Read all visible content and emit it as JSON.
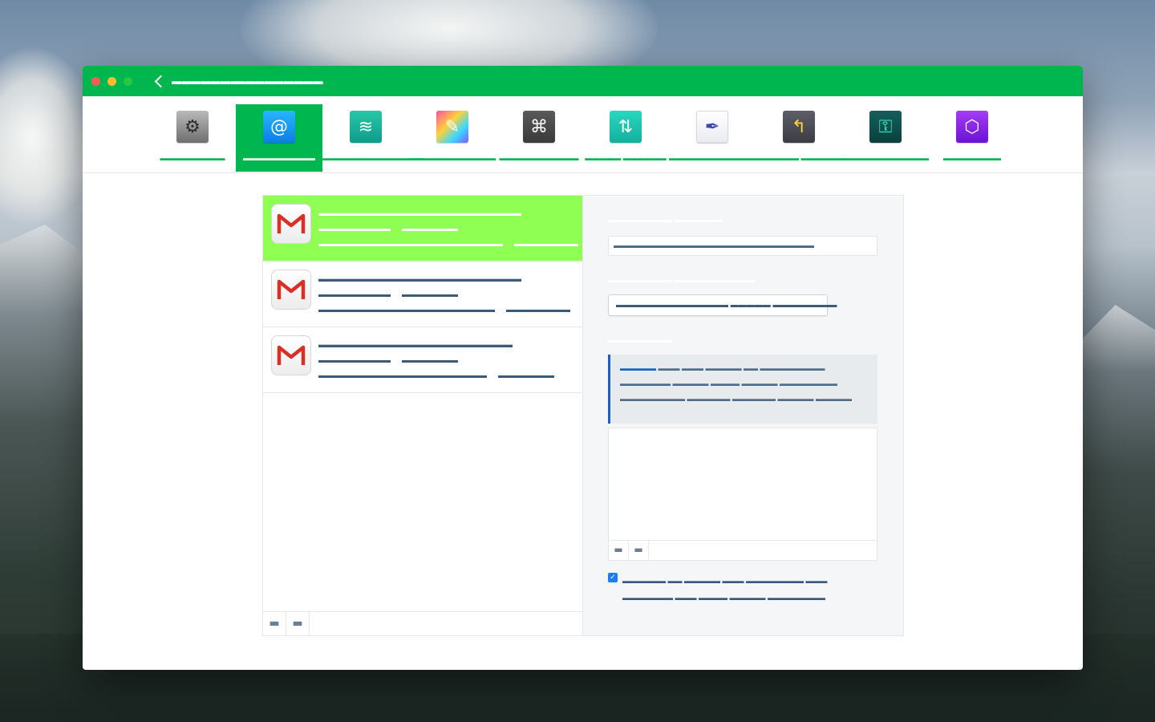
{
  "window": {
    "title_left": "▬▬▬▬▬▬▬",
    "title_right": "▬▬▬▬▬▬▬▬▬"
  },
  "toolbar": {
    "items": [
      {
        "label": "▬▬▬▬▬▬▬▬▬",
        "icon": "gear-icon",
        "color": "#8a8a8a",
        "glyph": "⚙"
      },
      {
        "label": "▬▬▬▬▬▬▬▬▬▬",
        "icon": "at-sign-icon",
        "color": "#1a9bf0",
        "glyph": "@"
      },
      {
        "label": "▬▬▬▬▬▬▬▬▬▬▬▬▬▬",
        "icon": "stripes-icon",
        "color": "#19b49b",
        "glyph": "≋"
      },
      {
        "label": "▬▬▬▬▬▬▬▬▬▬▬▬",
        "icon": "paintbrush-icon",
        "color": "#e44bd9",
        "glyph": "✎"
      },
      {
        "label": "▬▬▬▬▬▬▬▬▬▬▬",
        "icon": "command-icon",
        "color": "#4c4c4c",
        "glyph": "⌘"
      },
      {
        "label": "▬▬▬▬▬ ▬▬▬▬▬▬",
        "icon": "arrows-icon",
        "color": "#21c4b0",
        "glyph": "⇅"
      },
      {
        "label": "▬▬▬▬▬▬▬▬▬▬▬▬",
        "icon": "signature-icon",
        "color": "#f4f5f8",
        "glyph": "✒"
      },
      {
        "label": "▬▬▬▬▬▬ ▬▬▬▬▬▬",
        "icon": "undo-arrow-icon",
        "color": "#4b4b55",
        "glyph": "↰"
      },
      {
        "label": "▬▬▬▬▬▬▬▬▬▬▬▬",
        "icon": "key-icon",
        "color": "#0f4f4d",
        "glyph": "⚿"
      },
      {
        "label": "▬▬▬▬▬▬▬▬",
        "icon": "cube-icon",
        "color": "#8a2be2",
        "glyph": "⬡"
      }
    ]
  },
  "accounts": {
    "items": [
      {
        "line1": "▬▬▬▬▬▬▬▬▬▬▬▬▬▬▬▬▬▬▬▬▬▬▬",
        "line2a": "▬▬▬▬▬▬▬▬▬",
        "line2b": "▬▬▬▬▬▬▬",
        "line3a": "▬▬▬▬▬▬▬▬▬▬▬▬▬▬▬▬▬▬▬▬▬▬▬",
        "line3b": "▬▬▬▬▬▬▬▬"
      },
      {
        "line1": "▬▬▬▬▬▬▬▬▬▬▬▬▬▬▬▬▬▬▬▬▬▬▬",
        "line2a": "▬▬▬▬▬▬▬▬▬",
        "line2b": "▬▬▬▬▬▬▬",
        "line3a": "▬▬▬▬▬▬▬▬▬▬▬▬▬▬▬▬▬▬▬▬▬▬",
        "line3b": "▬▬▬▬▬▬▬▬"
      },
      {
        "line1": "▬▬▬▬▬▬▬▬▬▬▬▬▬▬▬▬▬▬▬▬▬▬",
        "line2a": "▬▬▬▬▬▬▬▬▬",
        "line2b": "▬▬▬▬▬▬▬",
        "line3a": "▬▬▬▬▬▬▬▬▬▬▬▬▬▬▬▬▬▬▬▬▬",
        "line3b": "▬▬▬▬▬▬▬"
      }
    ],
    "add_label": "▬",
    "remove_label": "▬"
  },
  "details": {
    "field1_label_a": "▬▬▬▬▬▬▬▬",
    "field1_label_b": "▬▬▬▬▬▬",
    "field1_value": "▬▬▬▬▬▬▬▬▬▬▬▬▬▬▬▬▬▬▬▬▬▬▬▬▬",
    "field2_label_a": "▬▬▬▬▬▬▬▬",
    "field2_label_b": "▬▬▬▬▬▬▬▬▬▬",
    "field2_value": "▬▬▬▬▬▬▬▬▬▬▬▬▬▬  ▬▬▬▬▬  ▬▬▬▬▬▬▬▬",
    "section_label": "▬▬▬▬▬▬▬▬",
    "note_strong": "▬▬▬▬▬",
    "note_text": "  ▬▬▬  ▬▬▬  ▬▬▬▬▬  ▬▬  ▬▬▬▬▬▬▬▬▬  ▬▬▬▬▬▬▬  ▬▬▬▬▬  ▬▬▬▬  ▬▬▬▬▬  ▬▬▬▬▬▬▬▬  ▬▬▬▬▬▬▬▬▬  ▬▬▬▬▬▬  ▬▬▬▬▬▬  ▬▬▬▬▬  ▬▬▬▬▬",
    "list_add": "▬",
    "list_remove": "▬",
    "checkbox_checked": true,
    "checkbox_text": "▬▬▬▬▬▬  ▬▬  ▬▬▬▬▬  ▬▬▬  ▬▬▬▬▬▬▬▬  ▬▬▬  ▬▬▬▬▬▬▬  ▬▬▬  ▬▬▬▬  ▬▬▬▬▬  ▬▬▬▬▬▬▬▬"
  }
}
